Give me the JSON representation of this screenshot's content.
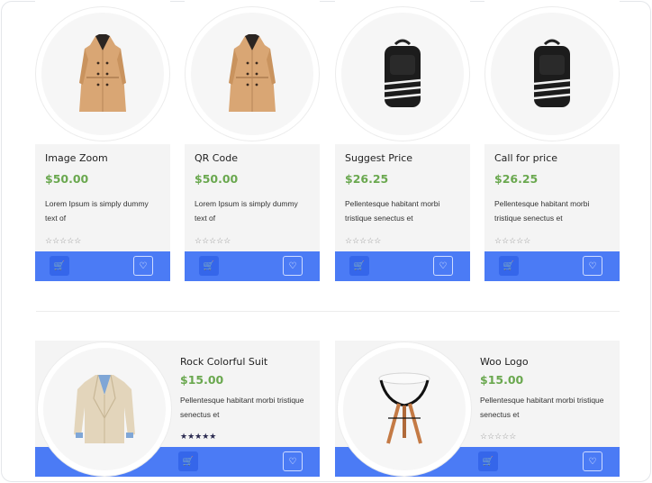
{
  "products_top": [
    {
      "name": "Image Zoom",
      "price": "$50.00",
      "desc": "Lorem Ipsum is simply dummy text of",
      "rating": "☆☆☆☆☆",
      "image": "coat"
    },
    {
      "name": "QR Code",
      "price": "$50.00",
      "desc": "Lorem Ipsum is simply dummy text of",
      "rating": "☆☆☆☆☆",
      "image": "coat"
    },
    {
      "name": "Suggest Price",
      "price": "$26.25",
      "desc": "Pellentesque habitant morbi tristique senectus et",
      "rating": "☆☆☆☆☆",
      "image": "backpack"
    },
    {
      "name": "Call for price",
      "price": "$26.25",
      "desc": "Pellentesque habitant morbi tristique senectus et",
      "rating": "☆☆☆☆☆",
      "image": "backpack"
    }
  ],
  "products_bottom": [
    {
      "name": "Rock Colorful Suit",
      "price": "$15.00",
      "desc": "Pellentesque habitant morbi tristique senectus et",
      "rating": "★★★★★",
      "image": "blazer"
    },
    {
      "name": "Woo Logo",
      "price": "$15.00",
      "desc": "Pellentesque habitant morbi tristique senectus et",
      "rating": "☆☆☆☆☆",
      "image": "stool"
    }
  ],
  "icons": {
    "cart": "cart-icon",
    "wishlist": "heart-icon"
  },
  "colors": {
    "accent": "#4b7bf5",
    "price": "#6aa84f",
    "card_bg": "#f4f4f4"
  }
}
